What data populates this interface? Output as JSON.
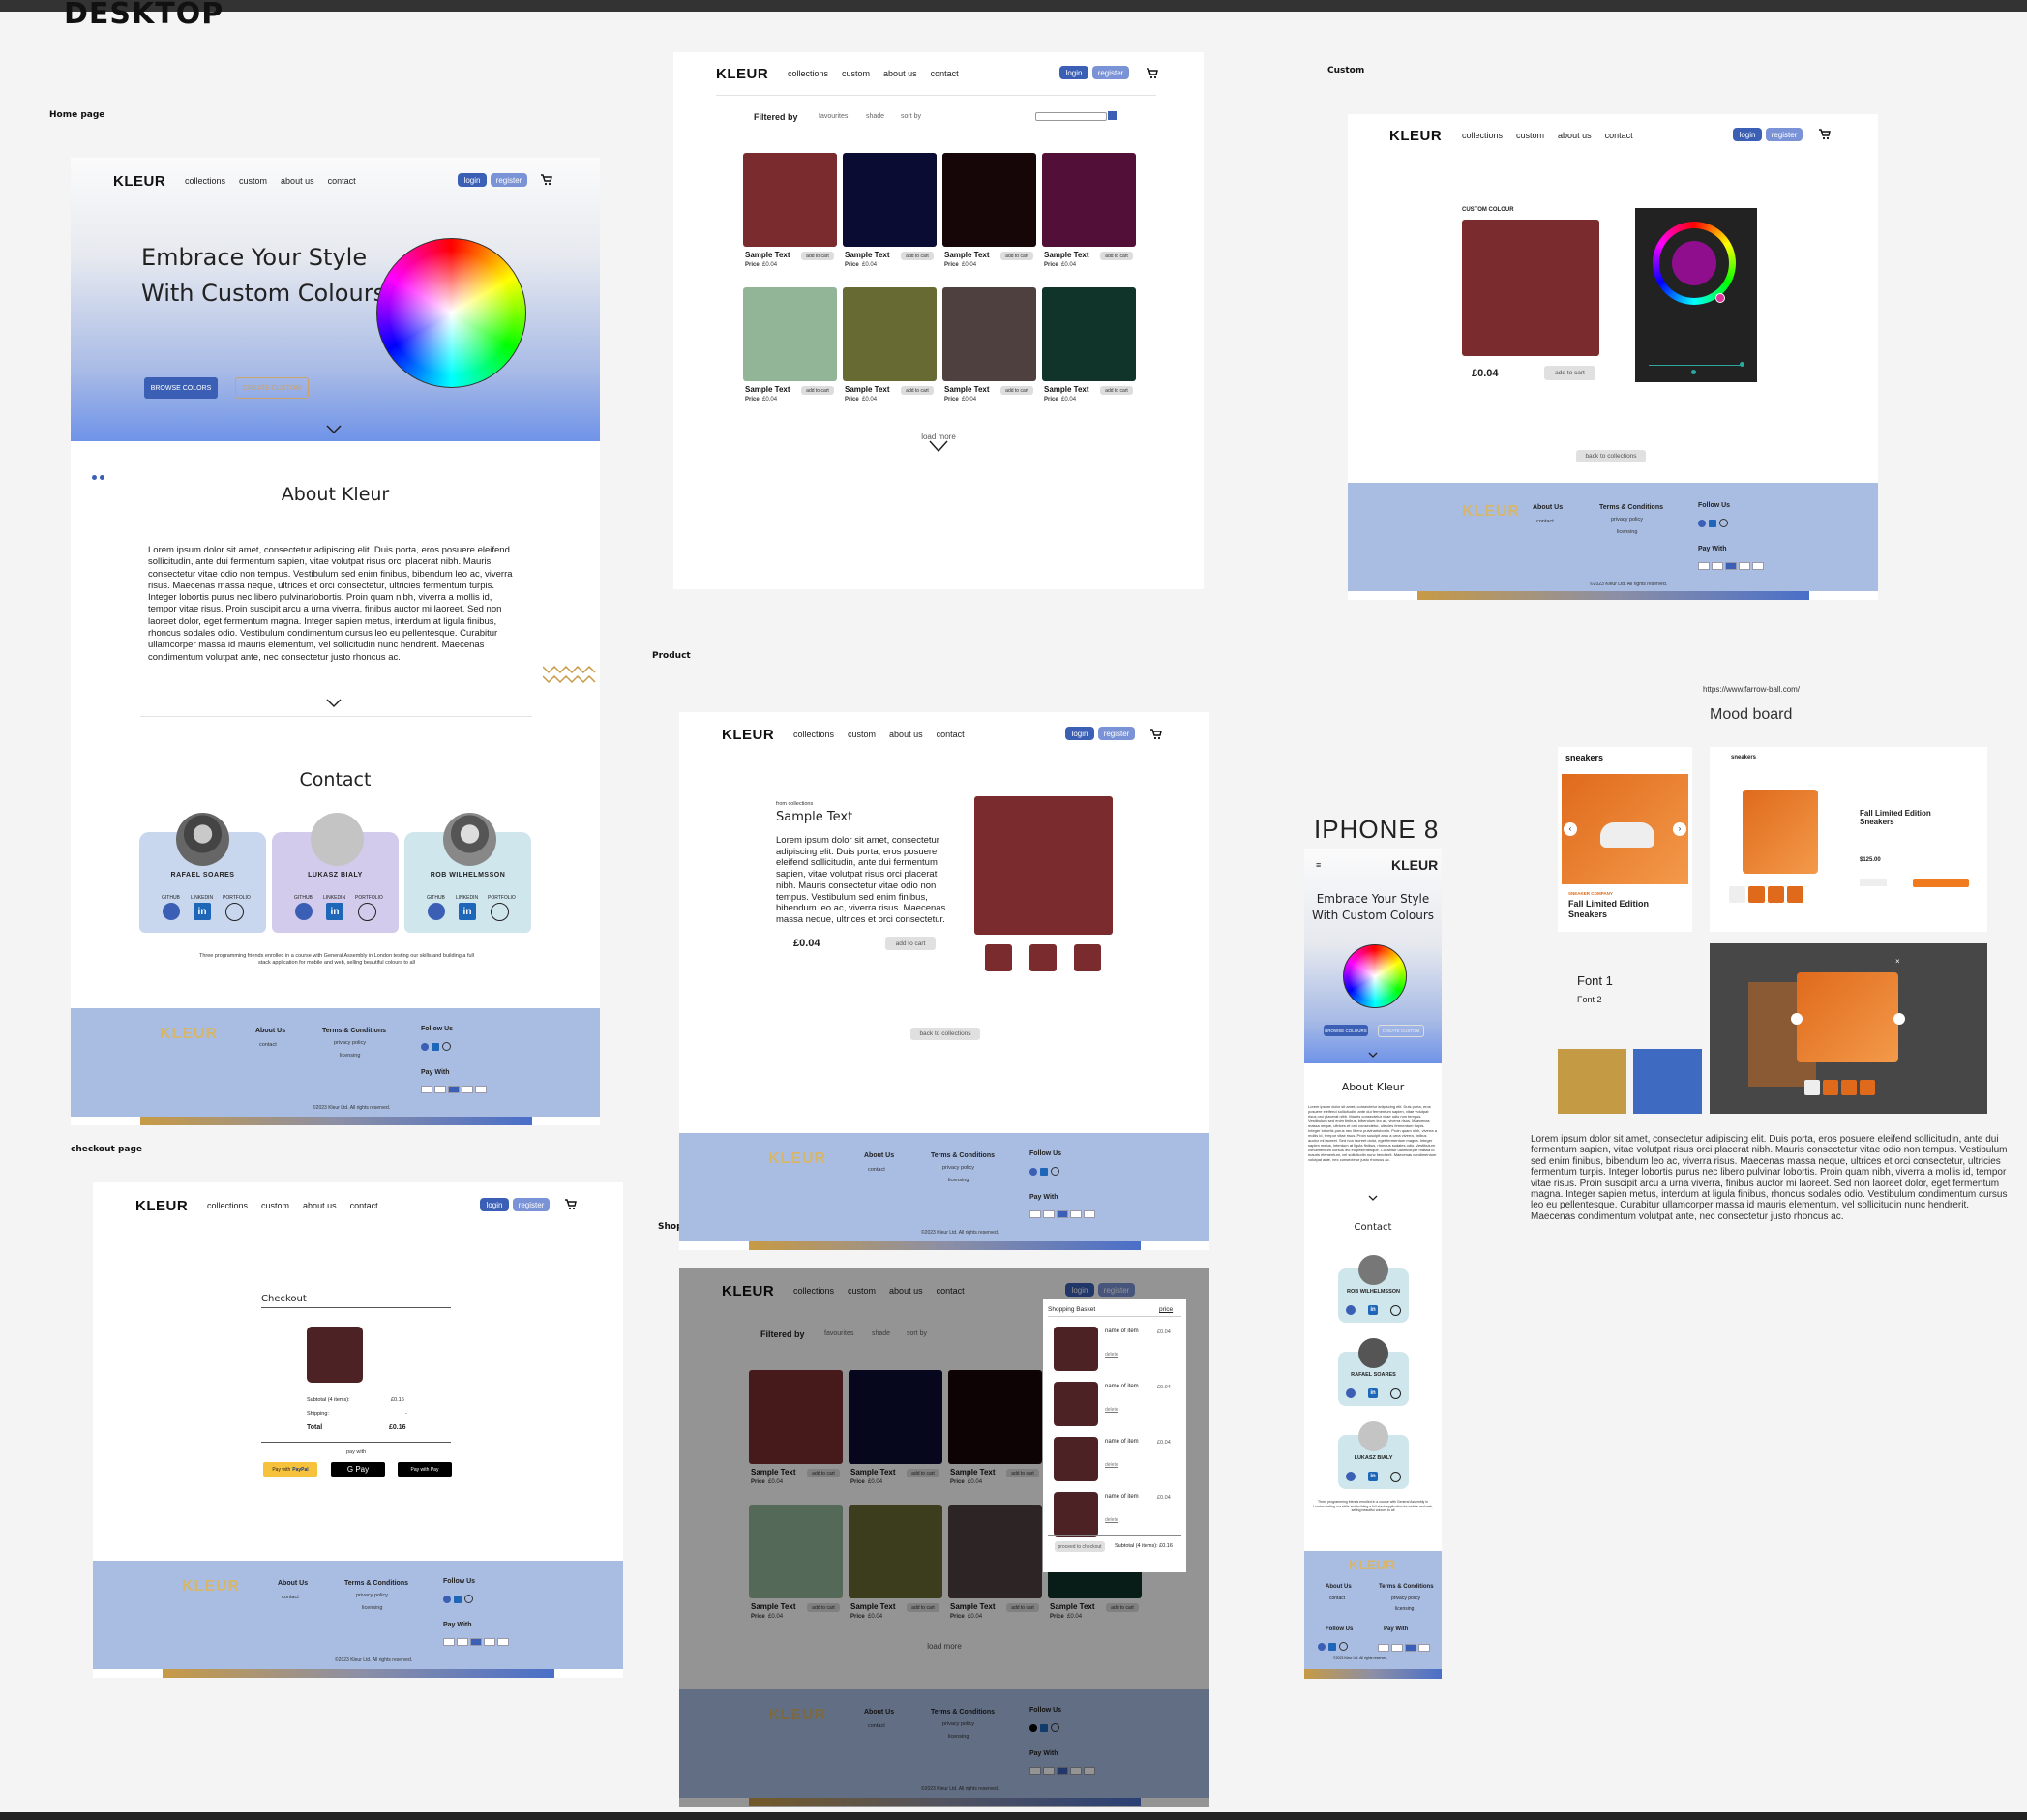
{
  "canvas": {
    "desktop_label": "DESKTOP",
    "home_label": "Home page",
    "checkout_label": "checkout page",
    "product_label": "Product",
    "shop_label": "Shop",
    "custom_label": "Custom",
    "iphone_label": "IPHONE 8",
    "url_label": "https://www.farrow-ball.com/",
    "mood_label": "Mood board"
  },
  "nav": {
    "logo": "KLEUR",
    "links": [
      "collections",
      "custom",
      "about us",
      "contact"
    ],
    "login": "login",
    "register": "register"
  },
  "home": {
    "hero_line1": "Embrace Your Style",
    "hero_line2": "With Custom Colours",
    "browse": "BROWSE COLORS",
    "create": "CREATE CUSTOM",
    "about_title": "About Kleur",
    "about_text": "Lorem ipsum dolor sit amet, consectetur adipiscing elit. Duis porta, eros posuere eleifend sollicitudin, ante dui fermentum sapien, vitae volutpat risus orci placerat nibh. Mauris consectetur vitae odio non tempus. Vestibulum sed enim finibus, bibendum leo ac, viverra risus. Maecenas massa neque, ultrices et orci consectetur, ultricies fermentum turpis. Integer lobortis purus nec libero pulvinarlobortis. Proin quam nibh, viverra a mollis id, tempor vitae risus. Proin suscipit arcu a urna viverra, finibus auctor mi laoreet. Sed non laoreet dolor, eget fermentum magna. Integer sapien metus, interdum at ligula finibus, rhoncus sodales odio. Vestibulum condimentum cursus leo eu pellentesque. Curabitur ullamcorper massa id mauris elementum, vel sollicitudin nunc hendrerit. Maecenas condimentum volutpat ante, nec consectetur justo rhoncus ac.",
    "contact_title": "Contact",
    "contact_blurb": "Three programming friends enrolled in a course with General Assembly in London testing our skills and building a full stack application for mobile and web, selling beautiful colours to all",
    "people": [
      "RAFAEL SOARES",
      "LUKASZ BIALY",
      "ROB WILHELMSSON"
    ],
    "icon_labels": [
      "GITHUB",
      "LINKEDIN",
      "PORTFOLIO"
    ]
  },
  "footer": {
    "logo": "KLEUR",
    "about": "About Us",
    "about_item": "contact",
    "terms": "Terms & Conditions",
    "terms_items": [
      "privacy policy",
      "licensing"
    ],
    "follow": "Follow Us",
    "pay": "Pay With",
    "copyright": "©2023 Kleur Ltd. All rights reserved."
  },
  "collections": {
    "filtered_by": "Filtered by",
    "filters": [
      "favourites",
      "shade",
      "sort by"
    ],
    "sample_text": "Sample Text",
    "price_label": "Price",
    "price": "£0.04",
    "add_to_cart": "add to cart",
    "load_more": "load more",
    "colors": [
      "#792b2d",
      "#0b0c33",
      "#170607",
      "#521039",
      "#91b596",
      "#686a33",
      "#4f4040",
      "#10332a"
    ]
  },
  "custom": {
    "title": "CUSTOM COLOUR",
    "price": "£0.04",
    "add": "add to cart",
    "back": "back to collections",
    "color": "#792b2d"
  },
  "product": {
    "from": "from collections",
    "title": "Sample Text",
    "desc": "Lorem ipsum dolor sit amet, consectetur adipiscing elit. Duis porta, eros posuere eleifend sollicitudin, ante dui fermentum sapien, vitae volutpat risus orci placerat nibh. Mauris consectetur vitae odio non tempus. Vestibulum sed enim finibus, bibendum leo ac, viverra risus. Maecenas massa neque, ultrices et orci consectetur.",
    "price": "£0.04",
    "add": "add to cart",
    "back": "back to collections"
  },
  "checkout": {
    "title": "Checkout",
    "subtotal_label": "Subtotal (4 items):",
    "subtotal": "£0.16",
    "shipping_label": "Shipping:",
    "shipping": "-",
    "total_label": "Total",
    "total": "£0.16",
    "pay_with": "pay with",
    "paypal": "Pay with",
    "paypal_brand": "PayPal",
    "gpay": "G Pay",
    "applepay": "Pay with  Pay"
  },
  "basket": {
    "title": "Shopping Basket",
    "price_head": "price",
    "item_name": "name of item",
    "item_price": "£0.04",
    "delete": "delete",
    "proceed": "proceed to checkout",
    "subtotal": "Subtotal (4 items): £0.16"
  },
  "mood": {
    "brand": "sneakers",
    "caption_small": "SNEAKER COMPANY",
    "caption": "Fall Limited Edition Sneakers",
    "price": "$125.00",
    "font1": "Font 1",
    "font2": "Font 2",
    "text": "Lorem ipsum dolor sit amet, consectetur adipiscing elit. Duis porta, eros posuere eleifend sollicitudin, ante dui fermentum sapien, vitae volutpat risus orci placerat nibh. Mauris consectetur vitae odio non tempus. Vestibulum sed enim finibus, bibendum leo ac, viverra risus. Maecenas massa neque, ultrices et orci consectetur, ultricies fermentum turpis. Integer lobortis purus nec libero pulvinar lobortis. Proin quam nibh, viverra a mollis id, tempor vitae risus. Proin suscipit arcu a urna viverra, finibus auctor mi laoreet. Sed non laoreet dolor, eget fermentum magna. Integer sapien metus, interdum at ligula finibus, rhoncus sodales odio. Vestibulum condimentum cursus leo eu pellentesque. Curabitur ullamcorper massa id mauris elementum, vel sollicitudin nunc hendrerit. Maecenas condimentum volutpat ante, nec consectetur justo rhoncus ac.",
    "gold": "#c49a45",
    "blue": "#3f6ac2"
  },
  "mobile": {
    "hero": "Embrace Your Style With Custom Colours",
    "browse": "BROWSE COLOURS",
    "create": "CREATE CUSTOM",
    "about": "About Kleur",
    "contact": "Contact",
    "people": [
      "ROB WILHELMSSON",
      "RAFAEL SOARES",
      "LUKASZ BIALY"
    ]
  }
}
